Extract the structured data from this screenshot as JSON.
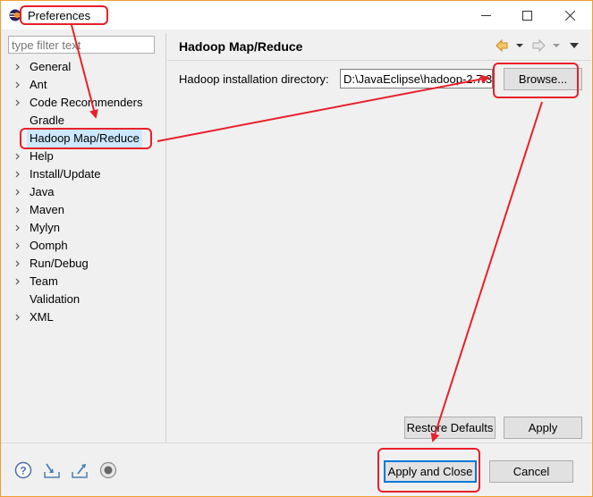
{
  "window": {
    "title": "Preferences"
  },
  "filter": {
    "placeholder": "type filter text"
  },
  "tree": {
    "items": [
      {
        "label": "General",
        "expandable": true
      },
      {
        "label": "Ant",
        "expandable": true
      },
      {
        "label": "Code Recommenders",
        "expandable": true
      },
      {
        "label": "Gradle",
        "expandable": false
      },
      {
        "label": "Hadoop Map/Reduce",
        "expandable": false,
        "selected": true
      },
      {
        "label": "Help",
        "expandable": true
      },
      {
        "label": "Install/Update",
        "expandable": true
      },
      {
        "label": "Java",
        "expandable": true
      },
      {
        "label": "Maven",
        "expandable": true
      },
      {
        "label": "Mylyn",
        "expandable": true
      },
      {
        "label": "Oomph",
        "expandable": true
      },
      {
        "label": "Run/Debug",
        "expandable": true
      },
      {
        "label": "Team",
        "expandable": true
      },
      {
        "label": "Validation",
        "expandable": false
      },
      {
        "label": "XML",
        "expandable": true
      }
    ]
  },
  "page": {
    "title": "Hadoop Map/Reduce",
    "dir_label": "Hadoop installation directory:",
    "dir_value": "D:\\JavaEclipse\\hadoop-2.7.3",
    "browse_label": "Browse...",
    "restore_label": "Restore Defaults",
    "apply_label": "Apply"
  },
  "footer": {
    "apply_close_label": "Apply and Close",
    "cancel_label": "Cancel"
  },
  "icons": [
    "help-icon",
    "import-icon",
    "export-icon",
    "record-icon",
    "back-icon",
    "forward-icon",
    "menu-icon"
  ],
  "colors": {
    "annotation": "#e8202a",
    "selection": "#cce8ff",
    "default_button_border": "#0078d7"
  }
}
